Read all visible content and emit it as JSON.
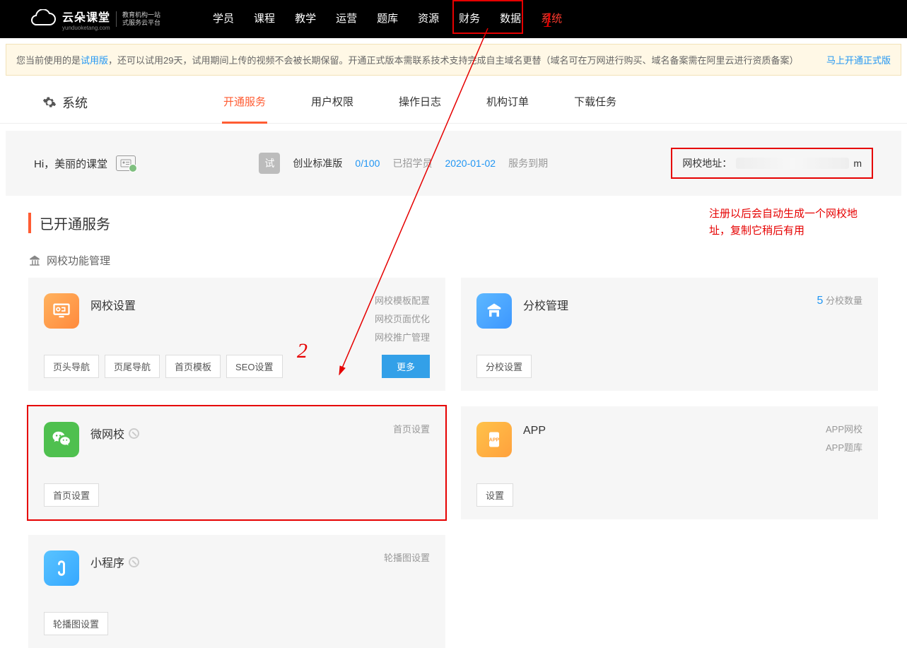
{
  "logo": {
    "main": "云朵课堂",
    "sub1": "教育机构一站",
    "sub2": "式服务云平台",
    "domain": "yunduoketang.com"
  },
  "nav": {
    "items": [
      "学员",
      "课程",
      "教学",
      "运营",
      "题库",
      "资源",
      "财务",
      "数据",
      "系统"
    ],
    "active": 8
  },
  "notice": {
    "prefix": "您当前使用的是",
    "trial": "试用版",
    "rest": "，还可以试用29天，试用期间上传的视频不会被长期保留。开通正式版本需联系技术支持完成自主域名更替（域名可在万网进行购买、域名备案需在阿里云进行资质备案）",
    "link": "马上开通正式版"
  },
  "subbar": {
    "title": "系统",
    "tabs": [
      "开通服务",
      "用户权限",
      "操作日志",
      "机构订单",
      "下载任务"
    ],
    "active": 0
  },
  "info": {
    "hi": "Hi，美丽的课堂",
    "planBadge": "试",
    "planName": "创业标准版",
    "enroll": "0/100",
    "enrollLabel": "已招学员",
    "expire": "2020-01-02",
    "expireLabel": "服务到期",
    "addrLabel": "网校地址：",
    "addrTail": "m"
  },
  "redNote": "注册以后会自动生成一个网校地址，复制它稍后有用",
  "section": {
    "title": "已开通服务",
    "sub": "网校功能管理"
  },
  "cards": [
    {
      "name": "网校设置",
      "rightLines": [
        "网校模板配置",
        "网校页面优化",
        "网校推广管理"
      ],
      "btns": [
        "页头导航",
        "页尾导航",
        "首页模板",
        "SEO设置"
      ],
      "more": "更多",
      "icon": "orange",
      "svg": "monitor"
    },
    {
      "name": "分校管理",
      "rightNum": "5",
      "rightTail": "分校数量",
      "btns": [
        "分校设置"
      ],
      "icon": "blue",
      "svg": "building"
    },
    {
      "name": "微网校",
      "locked": true,
      "rightLines": [
        "首页设置"
      ],
      "btns": [
        "首页设置"
      ],
      "icon": "green",
      "svg": "wechat",
      "highlight": true
    },
    {
      "name": "APP",
      "rightLines": [
        "APP网校",
        "APP题库"
      ],
      "btns": [
        "设置"
      ],
      "icon": "yellow",
      "svg": "app"
    },
    {
      "name": "小程序",
      "locked": true,
      "rightLines": [
        "轮播图设置"
      ],
      "btns": [
        "轮播图设置"
      ],
      "icon": "sky",
      "svg": "mini"
    }
  ],
  "anno": {
    "one": "1",
    "two": "2"
  }
}
